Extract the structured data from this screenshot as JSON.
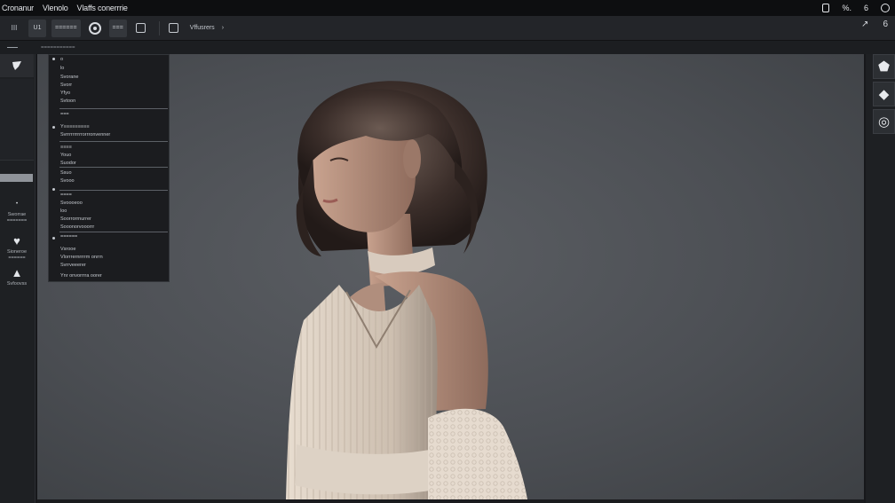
{
  "menubar": {
    "items": [
      "Cronanur",
      "Vlenolo",
      "Vlaffs conerrrie"
    ],
    "tray": [
      "6",
      "%.",
      "6",
      "••"
    ]
  },
  "toolbar": {
    "btn1": "III",
    "btn2": "U1",
    "btn3": "===",
    "btn4": "======",
    "btn5": "□",
    "text": "Vffusrers",
    "chevron": "›",
    "right1": "↗",
    "right2": "6"
  },
  "subbar": {
    "crumb": "==========="
  },
  "sidebar": {
    "tools": [
      {
        "label": "Sworrae",
        "sub": "======="
      },
      {
        "label": "Sioneroe",
        "sub": "======"
      },
      {
        "label": "Svfoovss",
        "sub": ""
      }
    ]
  },
  "layers": {
    "rows": [
      "o",
      "lo",
      "Svorane",
      "Svorr",
      "Yfyo",
      "Svtoon",
      "===",
      "Y≡≡≡≡≡≡≡≡≡",
      "Svrrrrrrrrrrorrronvenner",
      "≡≡≡≡",
      "Youo",
      "Suodor",
      "Ssuo",
      "Svooo",
      "====",
      "Svoooeoo",
      "loo",
      "Soorrorrnurrer",
      "Sooonorvooorrr",
      "======",
      "Vsrooe",
      "Vlorrrernrrrrm onrrn",
      "Svrrveeerer",
      "Ynr onvorrrra oorer"
    ]
  },
  "rightbar": {
    "buttons": [
      "⬟",
      "◆",
      "◎"
    ]
  }
}
